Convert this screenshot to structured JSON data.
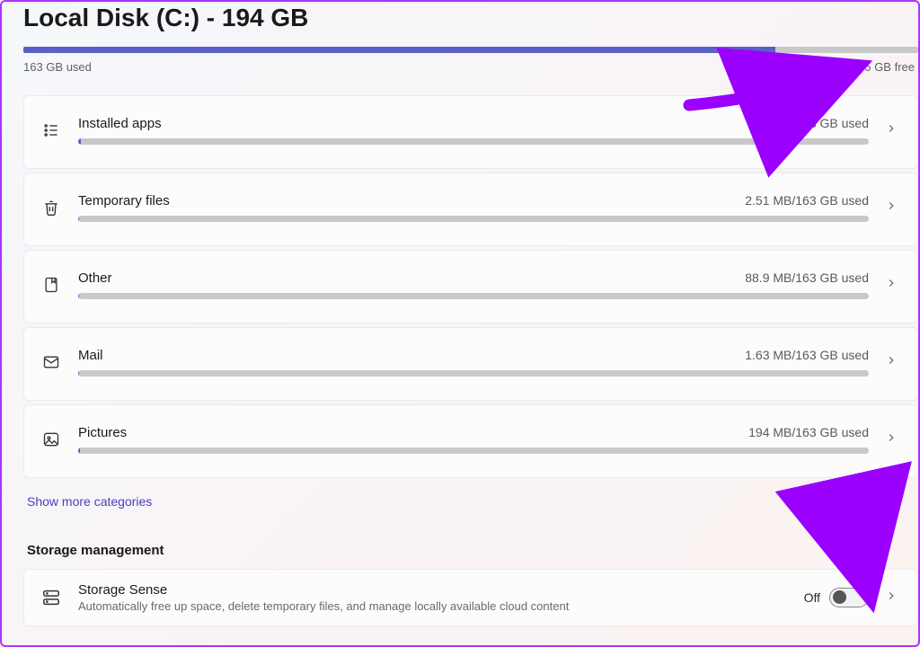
{
  "title": "Local Disk (C:) - 194 GB",
  "disk": {
    "used_label": "163 GB used",
    "free_label": "31.5 GB free",
    "used_pct": 84
  },
  "categories": [
    {
      "icon": "apps",
      "title": "Installed apps",
      "usage": "321 MB/163 GB used",
      "pct": 0.3
    },
    {
      "icon": "trash",
      "title": "Temporary files",
      "usage": "2.51 MB/163 GB used",
      "pct": 0.15
    },
    {
      "icon": "other",
      "title": "Other",
      "usage": "88.9 MB/163 GB used",
      "pct": 0.1
    },
    {
      "icon": "mail",
      "title": "Mail",
      "usage": "1.63 MB/163 GB used",
      "pct": 0.1
    },
    {
      "icon": "image",
      "title": "Pictures",
      "usage": "194 MB/163 GB used",
      "pct": 0.18
    }
  ],
  "show_more": "Show more categories",
  "section": "Storage management",
  "sense": {
    "title": "Storage Sense",
    "desc": "Automatically free up space, delete temporary files, and manage locally available cloud content",
    "state": "Off"
  }
}
